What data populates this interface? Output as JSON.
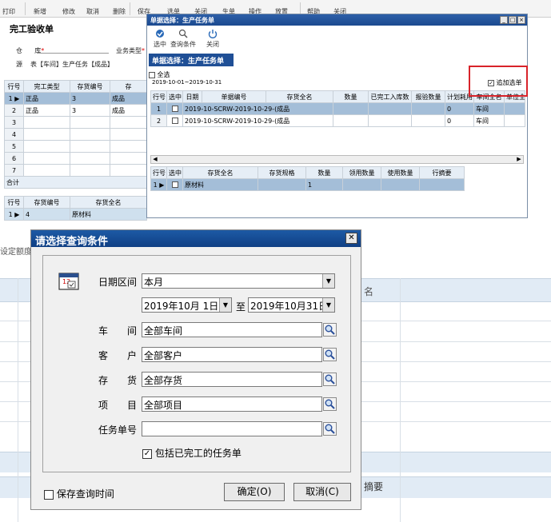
{
  "toolbar": [
    "打印",
    "新增",
    "修改",
    "取消",
    "删除",
    "保存",
    "选单",
    "关闭",
    "生单",
    "操作",
    "放置",
    "帮助",
    "关闭"
  ],
  "bg_form": {
    "title": "完工验收单",
    "warehouse_label": "仓",
    "warehouse_suffix": "库",
    "biz_type_label": "业务类型",
    "source_label": "源",
    "source_value": "表【车间】生产任务【成品】",
    "grid_headers": [
      "行号",
      "完工类型",
      "存货编号",
      "存"
    ],
    "grid_rows": [
      {
        "num": "1",
        "type": "正品",
        "code": "3",
        "inv": "成品"
      },
      {
        "num": "2",
        "type": "正品",
        "code": "3",
        "inv": "成品"
      },
      {
        "num": "3",
        "type": "",
        "code": "",
        "inv": ""
      },
      {
        "num": "4",
        "type": "",
        "code": "",
        "inv": ""
      },
      {
        "num": "5",
        "type": "",
        "code": "",
        "inv": ""
      },
      {
        "num": "6",
        "type": "",
        "code": "",
        "inv": ""
      },
      {
        "num": "7",
        "type": "",
        "code": "",
        "inv": ""
      }
    ],
    "total_label": "合计",
    "grid2_headers": [
      "行号",
      "存货编号",
      "存货全名"
    ],
    "grid2_row": {
      "num": "1",
      "code": "4",
      "name": "原材料"
    },
    "quota_label": "设定额度",
    "col_label_name": "名",
    "col_label_summary": "摘要"
  },
  "bill_window": {
    "title": "单据选择：生产任务单",
    "toolbar": {
      "select": "选中",
      "query": "查询条件",
      "close": "关闭"
    },
    "banner": "单据选择：生产任务单",
    "select_all": "全选",
    "date_range": "2019-10-01~2019-10-31",
    "append_select": "追加选单",
    "grid_headers": [
      "行号",
      "选中",
      "日期",
      "单据编号",
      "存货全名",
      "数量",
      "已完工入库数",
      "报验数量",
      "计划耗用",
      "车间全名",
      "单位全"
    ],
    "rows": [
      {
        "num": "1",
        "doc": "2019-10-SCRW-2019-10-29-(成品",
        "qty": "",
        "planned": "0",
        "workshop": "车间"
      },
      {
        "num": "2",
        "doc": "2019-10-SCRW-2019-10-29-(成品",
        "qty": "",
        "planned": "0",
        "workshop": "车间"
      }
    ],
    "detail_headers": [
      "行号",
      "选中",
      "存货全名",
      "存货规格",
      "数量",
      "领用数量",
      "使用数量",
      "行摘要"
    ],
    "detail_row": {
      "num": "1",
      "name": "原材料",
      "qty": "1"
    }
  },
  "dialog": {
    "title": "请选择查询条件",
    "date_range_label": "日期区间",
    "date_range_value": "本月",
    "from_date": "2019年10月 1日",
    "to_label": "至",
    "to_date": "2019年10月31日",
    "workshop_label": "车　　间",
    "workshop_value": "全部车间",
    "customer_label": "客　　户",
    "customer_value": "全部客户",
    "inventory_label": "存　　货",
    "inventory_value": "全部存货",
    "project_label": "项　　目",
    "project_value": "全部项目",
    "task_no_label": "任务单号",
    "task_no_value": "",
    "include_done_label": "包括已完工的任务单",
    "save_time_label": "保存查询时间",
    "ok_label": "确定(O)",
    "cancel_label": "取消(C)"
  }
}
